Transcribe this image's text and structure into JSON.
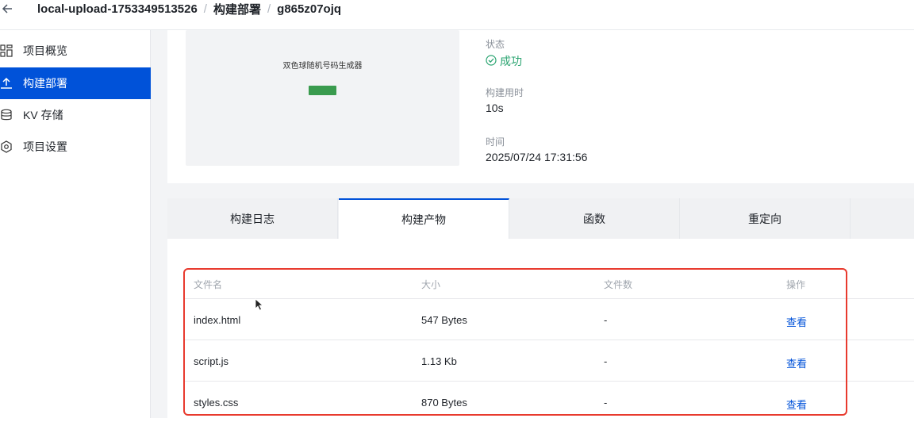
{
  "header": {
    "back_icon": "arrow-left-icon",
    "breadcrumb": [
      "local-upload-1753349513526",
      "构建部署",
      "g865z07ojq"
    ],
    "separator": "/"
  },
  "sidebar": {
    "items": [
      {
        "label": "项目概览",
        "icon": "overview-grid-icon",
        "active": false
      },
      {
        "label": "构建部署",
        "icon": "upload-icon",
        "active": true
      },
      {
        "label": "KV 存储",
        "icon": "database-icon",
        "active": false
      },
      {
        "label": "项目设置",
        "icon": "settings-icon",
        "active": false
      }
    ]
  },
  "preview": {
    "title": "双色球随机号码生成器",
    "button_color": "#3a9b4e"
  },
  "info": {
    "status_label": "状态",
    "status_value": "成功",
    "status_icon": "check-circle-icon",
    "duration_label": "构建用时",
    "duration_value": "10s",
    "time_label": "时间",
    "time_value": "2025/07/24 17:31:56"
  },
  "tabs": [
    {
      "label": "构建日志",
      "active": false
    },
    {
      "label": "构建产物",
      "active": true
    },
    {
      "label": "函数",
      "active": false
    },
    {
      "label": "重定向",
      "active": false
    }
  ],
  "table": {
    "columns": [
      "文件名",
      "大小",
      "文件数",
      "操作"
    ],
    "rows": [
      {
        "name": "index.html",
        "size": "547 Bytes",
        "count": "-",
        "action": "查看"
      },
      {
        "name": "script.js",
        "size": "1.13 Kb",
        "count": "-",
        "action": "查看"
      },
      {
        "name": "styles.css",
        "size": "870 Bytes",
        "count": "-",
        "action": "查看"
      }
    ]
  },
  "colors": {
    "accent": "#0052d9",
    "success": "#2ba471",
    "highlight_box": "#e83a2e"
  }
}
